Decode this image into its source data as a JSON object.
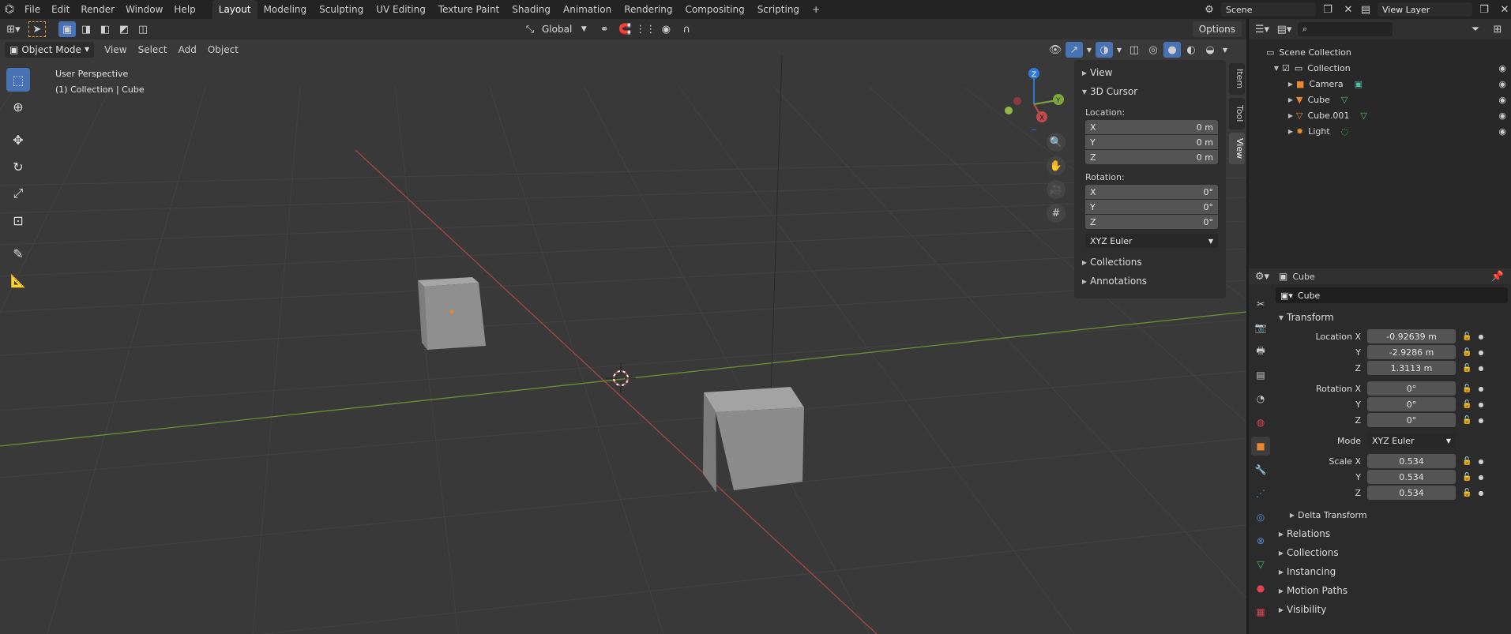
{
  "topbar": {
    "menus": [
      "File",
      "Edit",
      "Render",
      "Window",
      "Help"
    ],
    "workspaces": [
      "Layout",
      "Modeling",
      "Sculpting",
      "UV Editing",
      "Texture Paint",
      "Shading",
      "Animation",
      "Rendering",
      "Compositing",
      "Scripting"
    ],
    "active_workspace": "Layout",
    "add_tab": "+",
    "scene_name": "Scene",
    "view_layer": "View Layer"
  },
  "viewport_header": {
    "mode": "Object Mode",
    "menus": [
      "View",
      "Select",
      "Add",
      "Object"
    ],
    "transform_orientation": "Global",
    "options": "Options"
  },
  "viewport": {
    "perspective_label": "User Perspective",
    "collection_label": "(1) Collection | Cube",
    "gizmo": {
      "x": "X",
      "y": "Y",
      "z": "Z"
    }
  },
  "sidebar": {
    "tabs": [
      "Item",
      "Tool",
      "View"
    ],
    "active_tab": "View",
    "view_panel": "View",
    "cursor_panel": "3D Cursor",
    "location_label": "Location:",
    "location": [
      {
        "axis": "X",
        "value": "0 m"
      },
      {
        "axis": "Y",
        "value": "0 m"
      },
      {
        "axis": "Z",
        "value": "0 m"
      }
    ],
    "rotation_label": "Rotation:",
    "rotation": [
      {
        "axis": "X",
        "value": "0°"
      },
      {
        "axis": "Y",
        "value": "0°"
      },
      {
        "axis": "Z",
        "value": "0°"
      }
    ],
    "rotation_mode": "XYZ Euler",
    "collections_panel": "Collections",
    "annotations_panel": "Annotations"
  },
  "outliner": {
    "search_placeholder": "",
    "scene_collection": "Scene Collection",
    "collection": "Collection",
    "items": [
      "Camera",
      "Cube",
      "Cube.001",
      "Light"
    ]
  },
  "properties": {
    "object_name_header": "Cube",
    "object_name": "Cube",
    "transform_title": "Transform",
    "location_x_label": "Location X",
    "location": [
      "-0.92639 m",
      "-2.9286 m",
      "1.3113 m"
    ],
    "rotation_x_label": "Rotation X",
    "rotation": [
      "0°",
      "0°",
      "0°"
    ],
    "mode_label": "Mode",
    "mode_value": "XYZ Euler",
    "scale_x_label": "Scale X",
    "scale": [
      "0.534",
      "0.534",
      "0.534"
    ],
    "y_label": "Y",
    "z_label": "Z",
    "delta_transform": "Delta Transform",
    "sections": [
      "Relations",
      "Collections",
      "Instancing",
      "Motion Paths",
      "Visibility"
    ]
  },
  "colors": {
    "accent": "#4772b3",
    "x_axis": "#c24a4a",
    "y_axis": "#7ea83a",
    "z_axis": "#2d7ad6",
    "object_orange": "#e8872f"
  }
}
